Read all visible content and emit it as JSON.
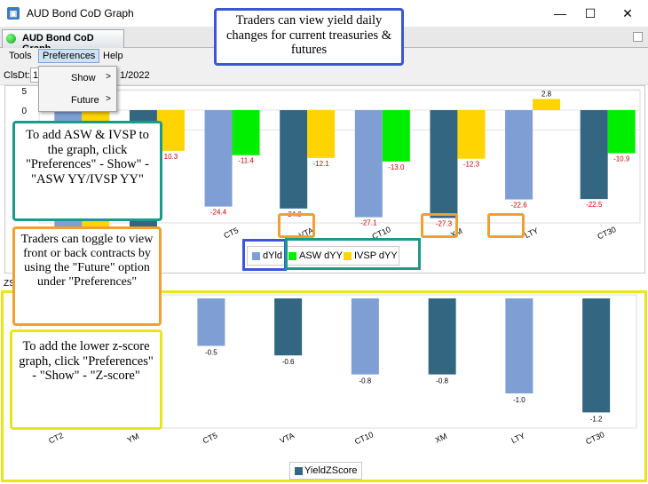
{
  "window": {
    "title": "AUD Bond CoD Graph",
    "minimize": "—",
    "maximize": "☐",
    "close": "✕"
  },
  "tab": {
    "label": "AUD Bond CoD Graph"
  },
  "menu": {
    "tools": "Tools",
    "preferences": "Preferences",
    "help": "Help"
  },
  "toolbar": {
    "clsdt_label": "ClsDt:",
    "date_fragment": "1/2022",
    "date_prefix": "1"
  },
  "dropdown": {
    "items": [
      {
        "label": "Show",
        "arrow": ">"
      },
      {
        "label": "Future",
        "arrow": ">"
      }
    ]
  },
  "zs_label": "ZS",
  "callouts": {
    "top": "Traders can view yield daily changes for current treasuries & futures",
    "asw": "To add ASW & IVSP to the graph, click \"Preferences\" - Show\" - \"ASW YY/IVSP YY\"",
    "toggle": "Traders can toggle to view front or back contracts by using the \"Future\" option under \"Preferences\"",
    "zscore": "To add the lower z-score graph, click \"Preferences\" - \"Show\" - \"Z-score\""
  },
  "colors": {
    "dyld_light": "#7f9fd4",
    "dyld_dark": "#336681",
    "asw": "#00ee00",
    "ivsp": "#ffd400",
    "label_red": "#cc0000"
  },
  "chart_data": [
    {
      "type": "bar",
      "categories": [
        "CT2",
        "YM",
        "CT5",
        "VTA",
        "CT10",
        "XM",
        "LTY",
        "CT30"
      ],
      "visible_category_labels": [
        "CT5",
        "VTA",
        "CT10",
        "XM",
        "LTY",
        "CT30"
      ],
      "y_ticks": [
        "5",
        "0",
        "-5"
      ],
      "series": [
        {
          "name": "dYld",
          "values": [
            null,
            null,
            -24.4,
            -24.9,
            -27.1,
            -27.3,
            -22.6,
            -22.5
          ],
          "labels": [
            "",
            "",
            "-24.4",
            "-24.9",
            "-27.1",
            "-27.3",
            "-22.6",
            "-22.5"
          ]
        },
        {
          "name": "ASW dYY",
          "values": [
            null,
            null,
            -11.4,
            null,
            -13.0,
            null,
            null,
            -10.9
          ],
          "labels": [
            "",
            "",
            "-11.4",
            "",
            "-13.0",
            "",
            "",
            "-10.9"
          ]
        },
        {
          "name": "IVSP dYY",
          "values": [
            null,
            -10.3,
            null,
            -12.1,
            null,
            -12.3,
            2.8,
            null
          ],
          "labels": [
            "",
            "10.3",
            "",
            "-12.1",
            "",
            "-12.3",
            "2.8",
            ""
          ]
        }
      ]
    },
    {
      "type": "bar",
      "categories": [
        "CT2",
        "YM",
        "CT5",
        "VTA",
        "CT10",
        "XM",
        "LTY",
        "CT30"
      ],
      "series": [
        {
          "name": "YieldZScore",
          "values": [
            null,
            null,
            -0.5,
            -0.6,
            -0.8,
            -0.8,
            -1.0,
            -1.2
          ],
          "labels": [
            "",
            "",
            "-0.5",
            "-0.6",
            "-0.8",
            "-0.8",
            "-1.0",
            "-1.2"
          ]
        }
      ]
    }
  ]
}
